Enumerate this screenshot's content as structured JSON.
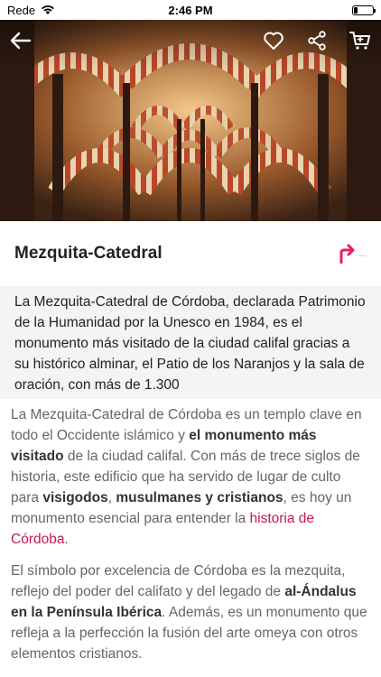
{
  "status_bar": {
    "carrier": "Rede",
    "time": "2:46 PM"
  },
  "header": {
    "icons": [
      "back-arrow-icon",
      "heart-icon",
      "share-icon",
      "cart-icon"
    ]
  },
  "place": {
    "title": "Mezquita-Catedral",
    "route_more": "..."
  },
  "summary": {
    "text": "La Mezquita-Catedral de Córdoba, declarada Patrimonio de la Humanidad por la Unesco en 1984, es el monumento más visitado de la ciudad califal gracias a su histórico alminar, el Patio de los Naranjos y la sala de oración, con más de 1.300"
  },
  "body": {
    "p1": {
      "t1": "La Mezquita-Catedral de Córdoba es un templo clave en todo el Occidente islámico y ",
      "b1": "el monumento más visitado",
      "t2": " de la ciudad califal. Con más de trece siglos de historia, este edificio que ha servido de lugar de culto para ",
      "b2": "visigodos",
      "t3": ", ",
      "b3": "musulmanes y cristianos",
      "t4": ", es hoy un monumento esencial para entender la ",
      "link": "historia de Córdoba",
      "t5": "."
    },
    "p2": {
      "t1": "El símbolo por excelencia de Córdoba es la mezquita, reflejo del poder del califato y del legado de ",
      "b1": "al-Ándalus en la Península Ibérica",
      "t2": ". Además, es un monumento que refleja a la perfección la fusión del arte omeya con otros elementos cristianos."
    }
  },
  "colors": {
    "accent": "#e91e63",
    "link": "#c2185b"
  }
}
